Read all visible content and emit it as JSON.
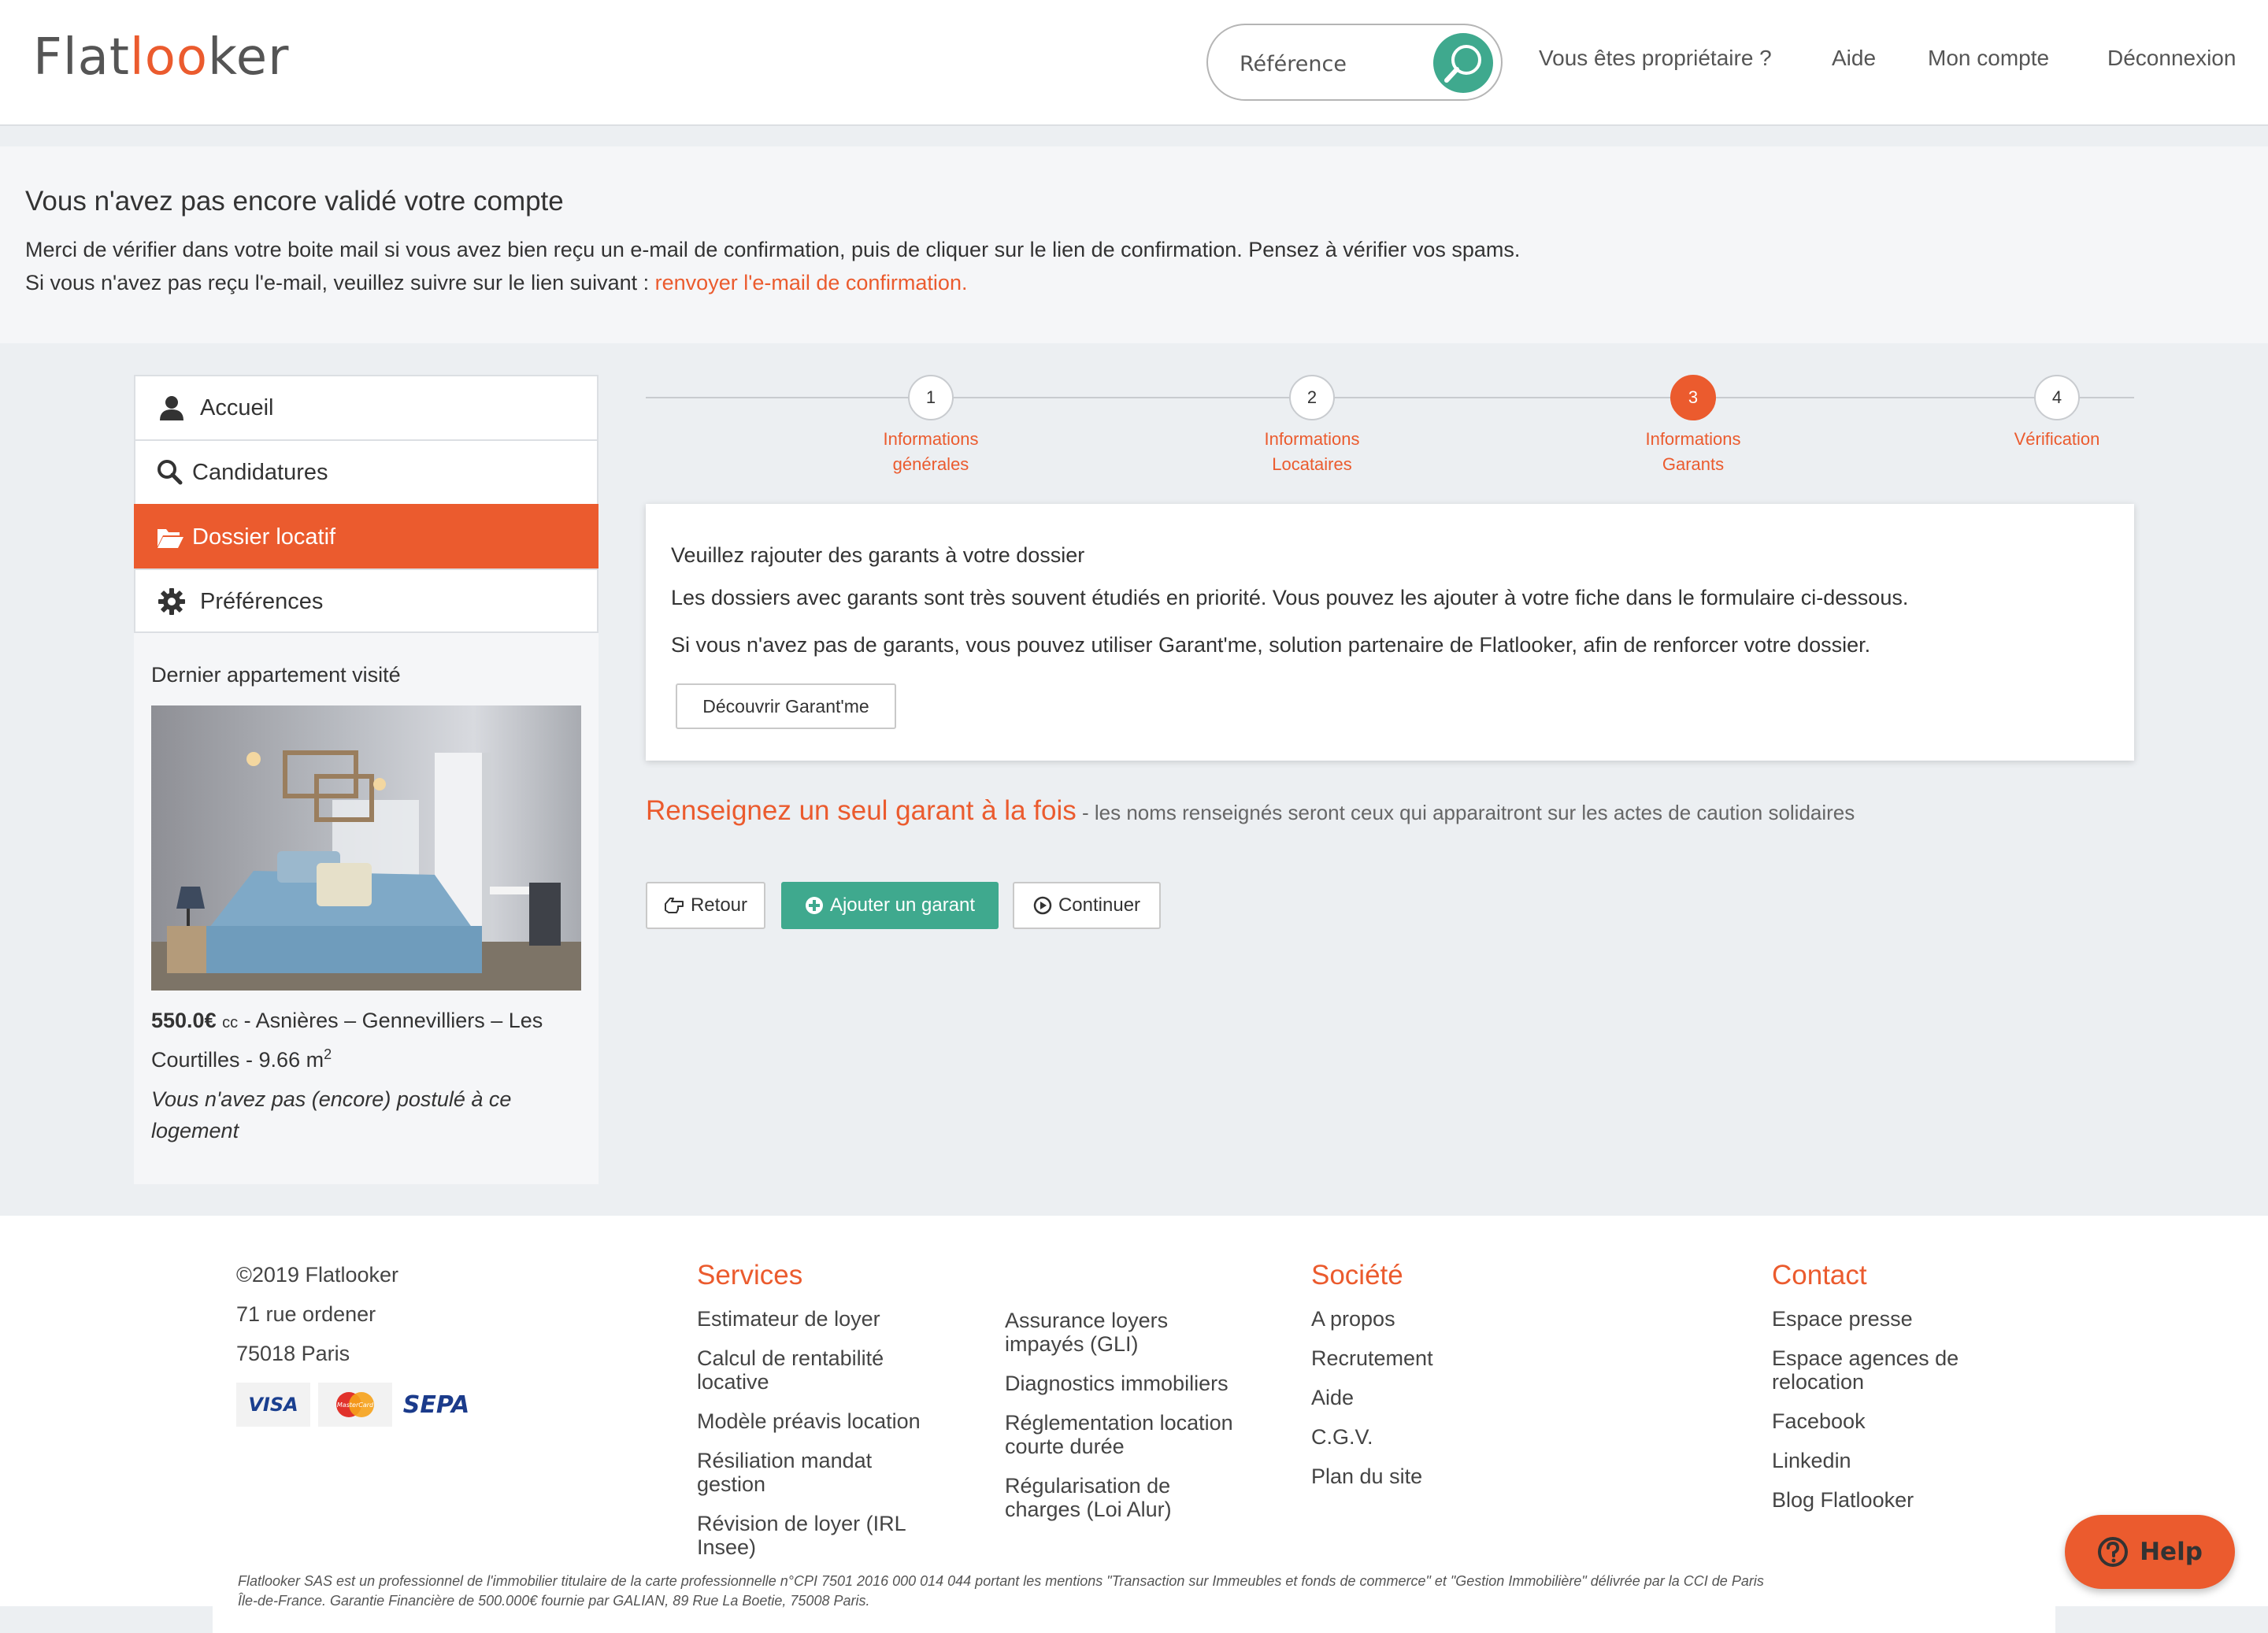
{
  "header": {
    "logo_part1": "Flat",
    "logo_part2": "l",
    "logo_part3": "oo",
    "logo_part4": "ker",
    "search_placeholder": "Référence",
    "nav": [
      "Vous êtes propriétaire ?",
      "Aide",
      "Mon compte",
      "Déconnexion"
    ]
  },
  "banner": {
    "title": "Vous n'avez pas encore validé votre compte",
    "line1": "Merci de vérifier dans votre boite mail si vous avez bien reçu un e-mail de confirmation, puis de cliquer sur le lien de confirmation. Pensez à vérifier vos spams.",
    "line2_prefix": "Si vous n'avez pas reçu l'e-mail, veuillez suivre sur le lien suivant : ",
    "line2_link": "renvoyer l'e-mail de confirmation."
  },
  "sidebar": {
    "items": [
      {
        "label": "Accueil",
        "icon": "user-icon"
      },
      {
        "label": "Candidatures",
        "icon": "search-icon"
      },
      {
        "label": "Dossier locatif",
        "icon": "folder-open-icon"
      },
      {
        "label": "Préférences",
        "icon": "gear-icon"
      }
    ],
    "last_visit_title": "Dernier appartement visité",
    "price": "550.0€",
    "price_suffix": "cc",
    "location": " - Asnières – Gennevilliers – Les Courtilles - 9.66 m",
    "area_sup": "2",
    "note": "Vous n'avez pas (encore) postulé à ce logement"
  },
  "stepper": {
    "steps": [
      {
        "number": "1",
        "label_l1": "Informations",
        "label_l2": "générales"
      },
      {
        "number": "2",
        "label_l1": "Informations",
        "label_l2": "Locataires"
      },
      {
        "number": "3",
        "label_l1": "Informations",
        "label_l2": "Garants"
      },
      {
        "number": "4",
        "label_l1": "Vérification",
        "label_l2": ""
      }
    ],
    "current": 3
  },
  "card": {
    "line1": "Veuillez rajouter des garants à votre dossier",
    "line2": "Les dossiers avec garants sont très souvent étudiés en priorité. Vous pouvez les ajouter à votre fiche dans le formulaire ci-dessous.",
    "line3": "Si vous n'avez pas de garants, vous pouvez utiliser Garant'me, solution partenaire de Flatlooker, afin de renforcer votre dossier.",
    "button": "Découvrir Garant'me"
  },
  "section": {
    "heading": "Renseignez un seul garant à la fois",
    "subheading": " - les noms renseignés seront ceux qui apparaitront sur les actes de caution solidaires"
  },
  "actions": {
    "back": "Retour",
    "add": "Ajouter un garant",
    "continue": "Continuer"
  },
  "footer": {
    "copyright": "©2019 Flatlooker",
    "address1": "71 rue ordener",
    "address2": "75018 Paris",
    "payment": [
      "VISA",
      "MasterCard",
      "SEPA"
    ],
    "services_title": "Services",
    "services_col1": [
      [
        "Estimateur de loyer",
        ""
      ],
      [
        "Calcul de rentabilité",
        "locative"
      ],
      [
        "Modèle préavis location",
        ""
      ],
      [
        "Résiliation mandat",
        "gestion"
      ],
      [
        "Révision de loyer (IRL",
        "Insee)"
      ]
    ],
    "services_col2": [
      [
        "Assurance loyers",
        "impayés (GLI)"
      ],
      [
        "Diagnostics immobiliers",
        ""
      ],
      [
        "Réglementation location",
        "courte durée"
      ],
      [
        "Régularisation de",
        "charges (Loi Alur)"
      ]
    ],
    "societe_title": "Société",
    "societe": [
      "A propos",
      "Recrutement",
      "Aide",
      "C.G.V.",
      "Plan du site"
    ],
    "contact_title": "Contact",
    "contact": [
      [
        "Espace presse",
        ""
      ],
      [
        "Espace agences de",
        "relocation"
      ],
      [
        "Facebook",
        ""
      ],
      [
        "Linkedin",
        ""
      ],
      [
        "Blog Flatlooker",
        ""
      ]
    ],
    "legal_l1": "Flatlooker SAS est un professionnel de l'immobilier titulaire de la carte professionnelle n°CPI 7501 2016 000 014 044 portant les mentions \"Transaction sur Immeubles et fonds de commerce\" et \"Gestion Immobilière\" délivrée par la CCI de Paris",
    "legal_l2": "Île-de-France. Garantie Financière de 500.000€ fournie par GALIAN, 89 Rue La Boetie, 75008 Paris."
  },
  "help": {
    "label": "Help"
  },
  "colors": {
    "accent": "#eb5b2e",
    "green": "#3fa98e"
  }
}
